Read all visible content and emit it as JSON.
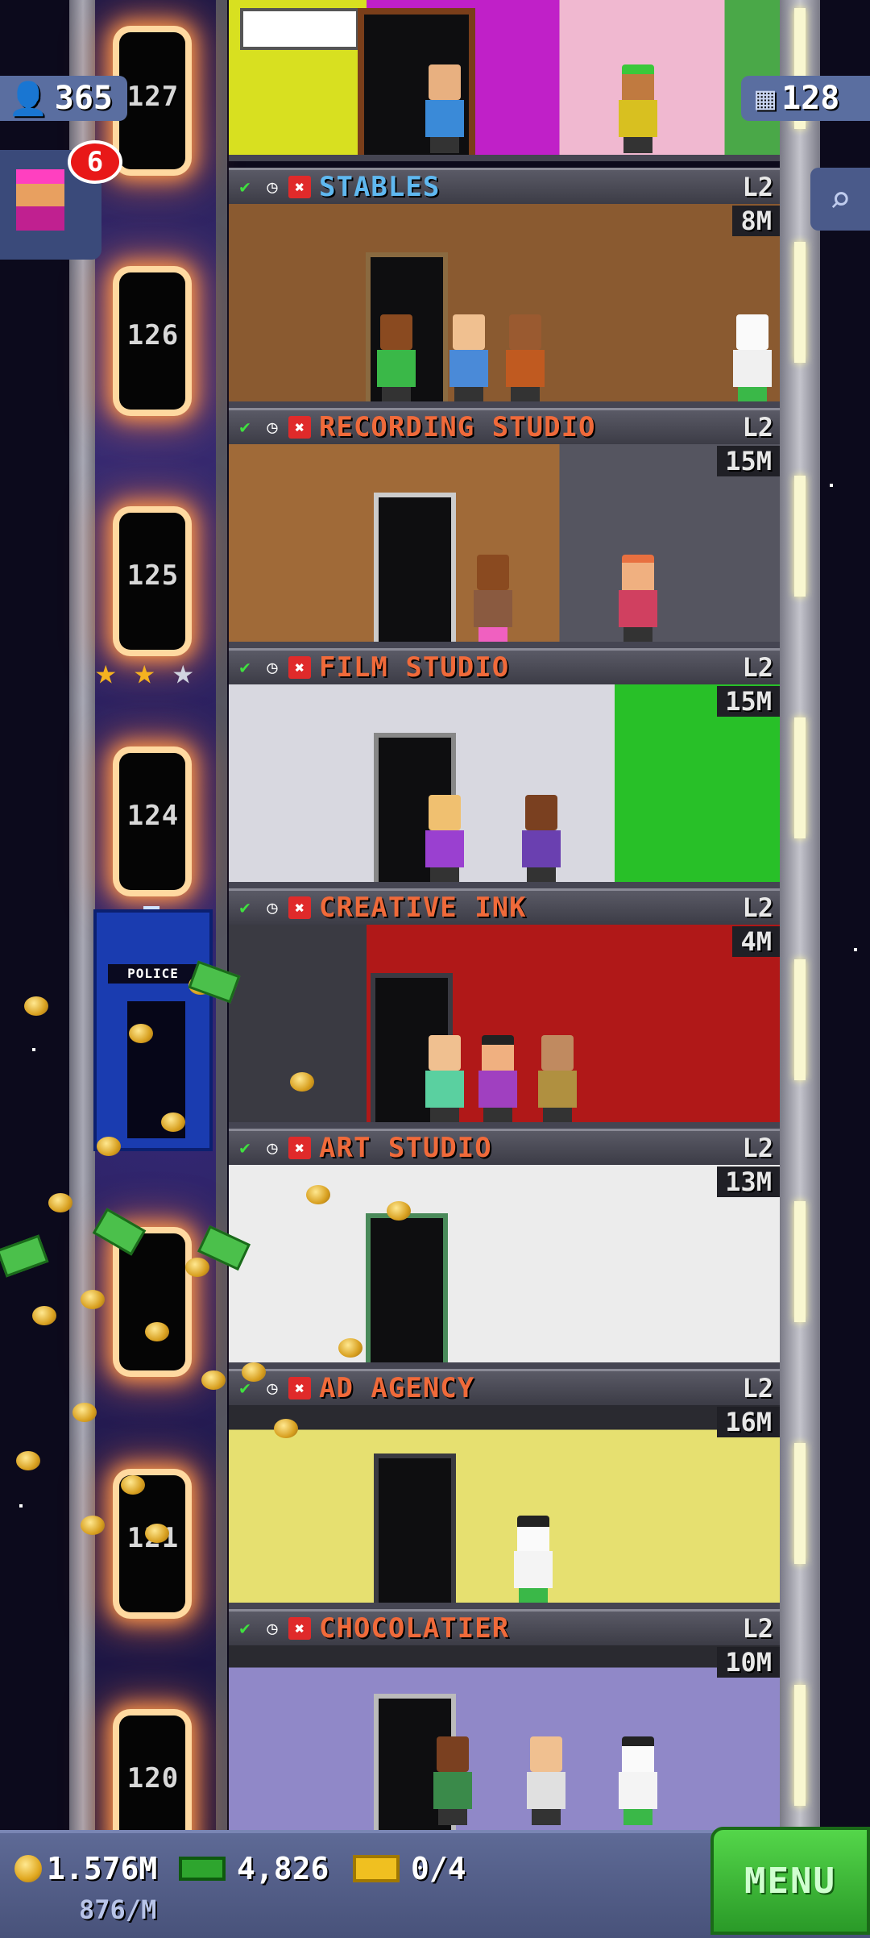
{
  "header": {
    "population": "365",
    "floors_count": "128",
    "notification_count": "6"
  },
  "shaft": {
    "floor_numbers": [
      "127",
      "126",
      "125",
      "124",
      "121",
      "120"
    ],
    "police_box_label": "POLICE"
  },
  "floors": [
    {
      "name": "STABLES",
      "level": "L2",
      "stock": "8M",
      "bg": "#8a5a30",
      "accent": "#5fb8f0"
    },
    {
      "name": "RECORDING STUDIO",
      "level": "L2",
      "stock": "15M",
      "bg": "#a06a38",
      "accent": "#f06a3a"
    },
    {
      "name": "FILM STUDIO",
      "level": "L2",
      "stock": "15M",
      "bg": "#d8d8e0",
      "accent": "#f06a3a"
    },
    {
      "name": "CREATIVE INK",
      "level": "L2",
      "stock": "4M",
      "bg": "#b01818",
      "accent": "#f06a3a"
    },
    {
      "name": "ART STUDIO",
      "level": "L2",
      "stock": "13M",
      "bg": "#ececec",
      "accent": "#f06a3a"
    },
    {
      "name": "AD AGENCY",
      "level": "L2",
      "stock": "16M",
      "bg": "#e6e070",
      "accent": "#f06a3a"
    },
    {
      "name": "CHOCOLATIER",
      "level": "L2",
      "stock": "10M",
      "bg": "#9088c8",
      "accent": "#f06a3a"
    }
  ],
  "bottom": {
    "coins": "1.576M",
    "rate": "876/M",
    "bux": "4,826",
    "tickets": "0/4",
    "menu_label": "MENU"
  },
  "icons": {
    "check": "✔",
    "clock": "◷",
    "close": "✖",
    "search": "⌕",
    "star": "★",
    "person": "👤",
    "building": "▦"
  },
  "colors": {
    "menu_green": "#3cc23a",
    "badge_blue": "#5a6ea0",
    "alert_red": "#e81818"
  }
}
